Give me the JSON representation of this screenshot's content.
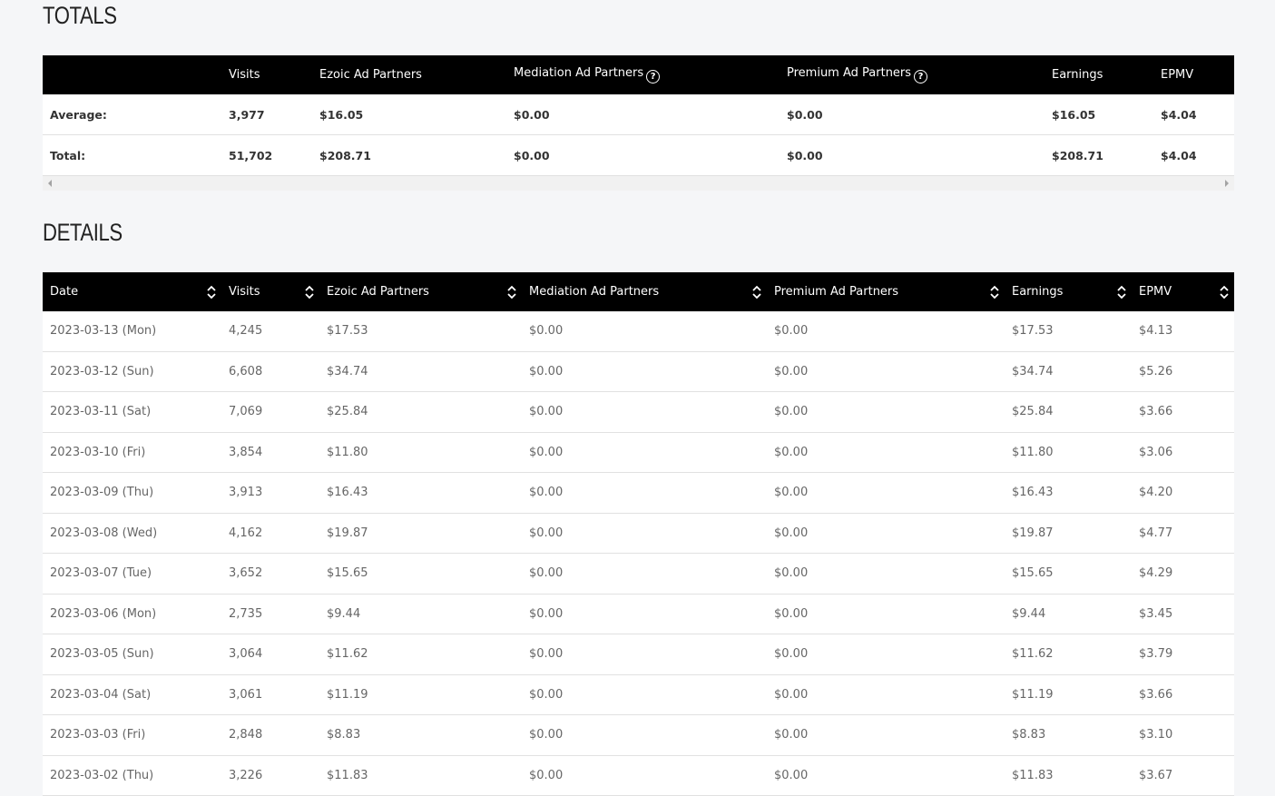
{
  "totals": {
    "title": "TOTALS",
    "columns": [
      "",
      "Visits",
      "Ezoic Ad Partners",
      "Mediation Ad Partners",
      "Premium Ad Partners",
      "Earnings",
      "EPMV"
    ],
    "help_columns": [
      3,
      4
    ],
    "rows": [
      [
        "Average:",
        "3,977",
        "$16.05",
        "$0.00",
        "$0.00",
        "$16.05",
        "$4.04"
      ],
      [
        "Total:",
        "51,702",
        "$208.71",
        "$0.00",
        "$0.00",
        "$208.71",
        "$4.04"
      ]
    ]
  },
  "details": {
    "title": "DETAILS",
    "columns": [
      "Date",
      "Visits",
      "Ezoic Ad Partners",
      "Mediation Ad Partners",
      "Premium Ad Partners",
      "Earnings",
      "EPMV"
    ],
    "rows": [
      [
        "2023-03-13 (Mon)",
        "4,245",
        "$17.53",
        "$0.00",
        "$0.00",
        "$17.53",
        "$4.13"
      ],
      [
        "2023-03-12 (Sun)",
        "6,608",
        "$34.74",
        "$0.00",
        "$0.00",
        "$34.74",
        "$5.26"
      ],
      [
        "2023-03-11 (Sat)",
        "7,069",
        "$25.84",
        "$0.00",
        "$0.00",
        "$25.84",
        "$3.66"
      ],
      [
        "2023-03-10 (Fri)",
        "3,854",
        "$11.80",
        "$0.00",
        "$0.00",
        "$11.80",
        "$3.06"
      ],
      [
        "2023-03-09 (Thu)",
        "3,913",
        "$16.43",
        "$0.00",
        "$0.00",
        "$16.43",
        "$4.20"
      ],
      [
        "2023-03-08 (Wed)",
        "4,162",
        "$19.87",
        "$0.00",
        "$0.00",
        "$19.87",
        "$4.77"
      ],
      [
        "2023-03-07 (Tue)",
        "3,652",
        "$15.65",
        "$0.00",
        "$0.00",
        "$15.65",
        "$4.29"
      ],
      [
        "2023-03-06 (Mon)",
        "2,735",
        "$9.44",
        "$0.00",
        "$0.00",
        "$9.44",
        "$3.45"
      ],
      [
        "2023-03-05 (Sun)",
        "3,064",
        "$11.62",
        "$0.00",
        "$0.00",
        "$11.62",
        "$3.79"
      ],
      [
        "2023-03-04 (Sat)",
        "3,061",
        "$11.19",
        "$0.00",
        "$0.00",
        "$11.19",
        "$3.66"
      ],
      [
        "2023-03-03 (Fri)",
        "2,848",
        "$8.83",
        "$0.00",
        "$0.00",
        "$8.83",
        "$3.10"
      ],
      [
        "2023-03-02 (Thu)",
        "3,226",
        "$11.83",
        "$0.00",
        "$0.00",
        "$11.83",
        "$3.67"
      ]
    ]
  },
  "icons": {
    "help": "question-circle-icon",
    "sort": "sort-up-down-icon",
    "scroll_left": "caret-left-icon",
    "scroll_right": "caret-right-icon"
  },
  "colors": {
    "header_bg": "#000000",
    "header_text": "#ffffff",
    "page_bg": "#f5f6f8",
    "row_bg": "#ffffff"
  }
}
